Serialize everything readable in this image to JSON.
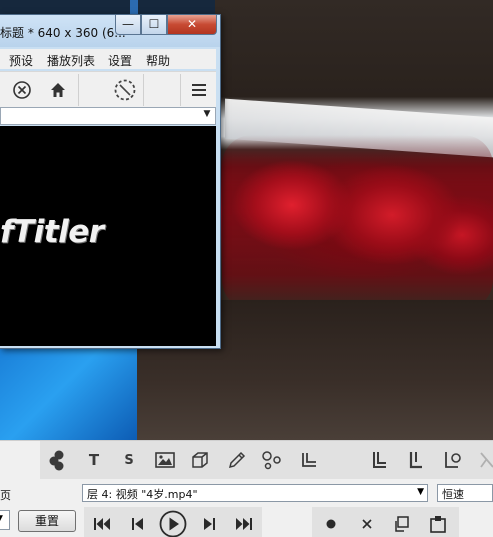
{
  "window": {
    "title": "标题 * 640 x 360 (6...",
    "menu": [
      "预设",
      "播放列表",
      "设置",
      "帮助"
    ],
    "controls": {
      "minimize": "—",
      "maximize": "☐",
      "close": "✕"
    },
    "preview_logo": "fTitler"
  },
  "bottom": {
    "left_label": "页",
    "layer_value": "层 4: 视频 \"4岁.mp4\"",
    "speed_value": "恒速",
    "reset_label": "重置",
    "icons": [
      "blob-shape-icon",
      "text-t-icon",
      "text-s-icon",
      "image-icon",
      "cube-icon",
      "pencil-icon",
      "particles-icon",
      "layer-corner-icon",
      "layer-link-icon",
      "layer-link-icon-2",
      "layer-link-icon-3"
    ],
    "text_icons": {
      "t": "T",
      "s": "S"
    }
  }
}
